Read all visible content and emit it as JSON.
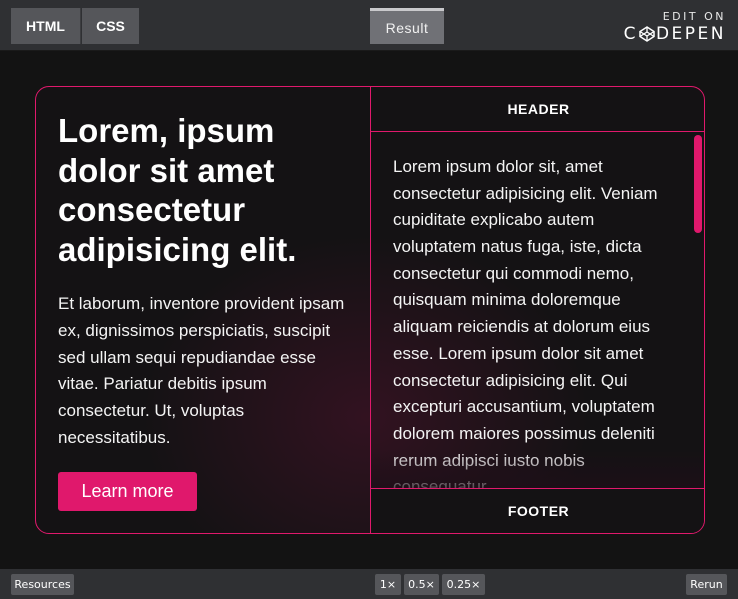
{
  "topbar": {
    "tabs": {
      "html": "HTML",
      "css": "CSS",
      "result": "Result"
    },
    "brand": {
      "edit_on": "EDIT ON",
      "logo_prefix": "C",
      "logo_suffix": "DEPEN"
    }
  },
  "card": {
    "heading": "Lorem, ipsum dolor sit amet consectetur adipisicing elit.",
    "body": "Et laborum, inventore provident ipsam ex, dignissimos perspiciatis, suscipit sed ullam sequi repudiandae esse vitae. Pariatur debitis ipsum consectetur. Ut, voluptas necessitatibus.",
    "cta_label": "Learn more",
    "header_label": "HEADER",
    "footer_label": "FOOTER",
    "scroll_text": "Lorem ipsum dolor sit, amet consectetur adipisicing elit. Veniam cupiditate explicabo autem voluptatem natus fuga, iste, dicta consectetur qui commodi nemo, quisquam minima doloremque aliquam reiciendis at dolorum eius esse. Lorem ipsum dolor sit amet consectetur adipisicing elit. Qui excepturi accusantium, voluptatem dolorem maiores possimus deleniti rerum adipisci iusto nobis consequatur"
  },
  "bottombar": {
    "resources": "Resources",
    "zoom": [
      "1×",
      "0.5×",
      "0.25×"
    ],
    "rerun": "Rerun"
  },
  "colors": {
    "accent": "#e0186c",
    "bar": "#2f3033",
    "button": "#55565a"
  },
  "icons": {
    "codepen_logo": "codepen-cube-icon"
  }
}
